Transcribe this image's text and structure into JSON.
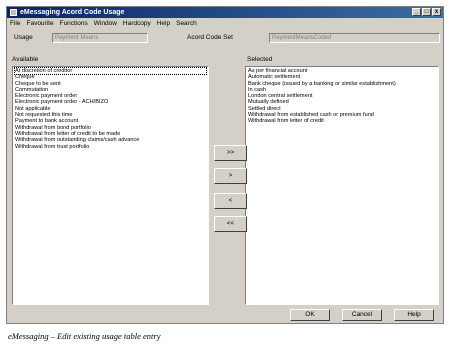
{
  "window": {
    "title": "eMessaging Acord Code Usage",
    "controls": [
      "_",
      "□",
      "x"
    ]
  },
  "menu": [
    {
      "label": "File"
    },
    {
      "label": "Favourite"
    },
    {
      "label": "Functions"
    },
    {
      "label": "Window"
    },
    {
      "label": "Hardcopy"
    },
    {
      "label": "Help"
    },
    {
      "label": "Search"
    }
  ],
  "usage": {
    "label": "Usage",
    "value": "Payment Means"
  },
  "codeset": {
    "label": "Acord Code Set",
    "value": "PaymentMeansCoded"
  },
  "available": {
    "label": "Available",
    "items": [
      "At discretion of creditor",
      "Cheque",
      "Cheque to be sent",
      "Commutation",
      "Electronic payment order",
      "Electronic payment order - ACH/BIZO",
      "Not applicable",
      "Not requested this time",
      "Payment to bank account",
      "Withdrawal from bond portfolio",
      "Withdrawal from letter of credit to be made",
      "Withdrawal from outstanding claims/cash advance",
      "Withdrawal from trust portfolio"
    ]
  },
  "selected": {
    "label": "Selected",
    "items": [
      "As per financial account",
      "Automatic settlement",
      "Bank cheque (issued by a banking or similar establishment)",
      "In cash",
      "London central settlement",
      "Mutually defined",
      "Settled direct",
      "Withdrawal from established cash or premium fund",
      "Withdrawal from letter of credit"
    ]
  },
  "move_buttons": {
    "add_all": ">>",
    "add": ">",
    "remove": "<",
    "remove_all": "<<"
  },
  "buttons": {
    "ok": "OK",
    "cancel": "Cancel",
    "help": "Help"
  },
  "caption": "eMessaging – Edit existing usage table entry"
}
